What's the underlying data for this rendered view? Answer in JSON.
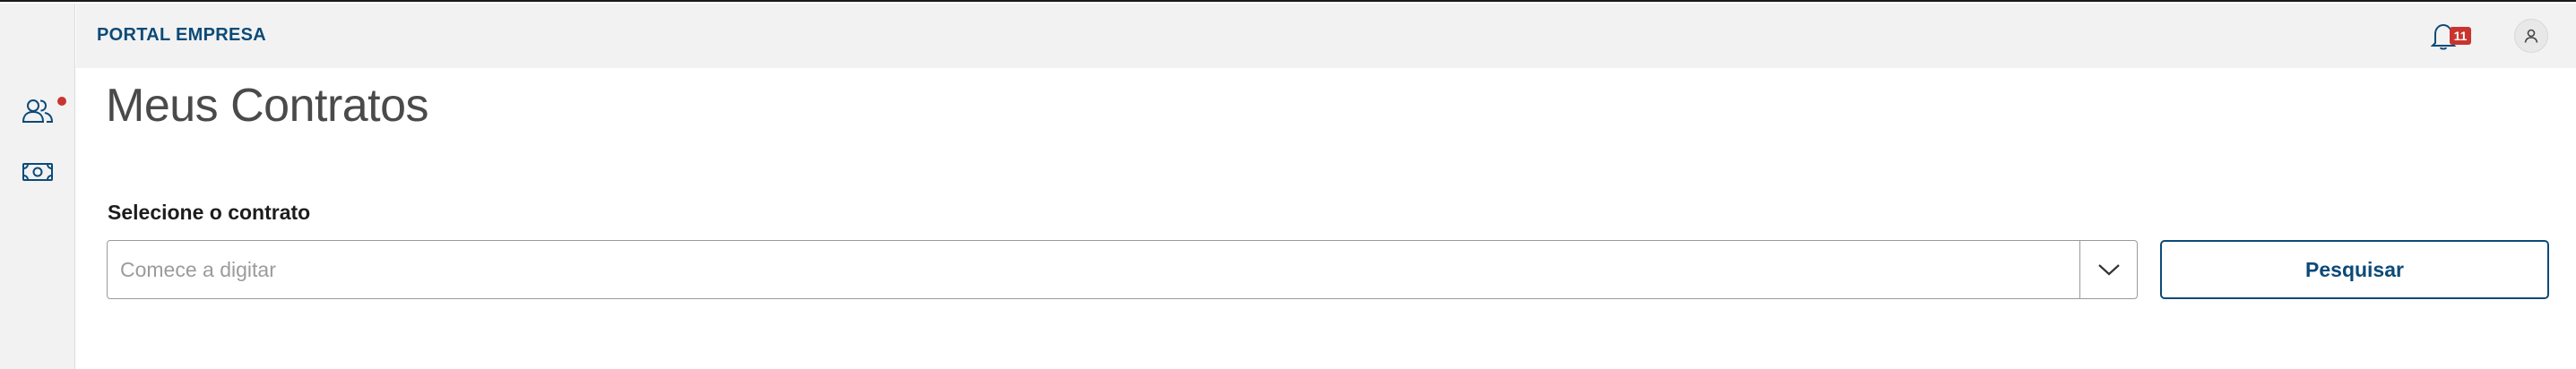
{
  "header": {
    "portal_title": "PORTAL EMPRESA",
    "notifications_count": "11"
  },
  "sidebar": {
    "items": [
      {
        "name": "contracts",
        "icon": "users-icon",
        "has_alert": true
      },
      {
        "name": "finance",
        "icon": "banknote-icon",
        "has_alert": false
      }
    ]
  },
  "main": {
    "title": "Meus Contratos",
    "contract_select": {
      "label": "Selecione o contrato",
      "placeholder": "Comece a digitar",
      "value": ""
    },
    "search_button_label": "Pesquisar"
  },
  "colors": {
    "brand": "#0c4a78",
    "alert": "#c8352f",
    "chrome_bg": "#f2f2f2"
  }
}
